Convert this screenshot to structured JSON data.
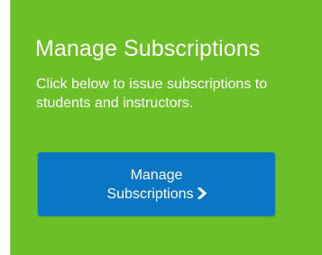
{
  "card": {
    "title": "Manage Subscriptions",
    "description": "Click below to issue subscriptions to students and instructors.",
    "background_color": "#6cbf26",
    "button": {
      "label_line1": "Manage",
      "label_line2": "Subscriptions",
      "icon": "chevron-right-icon",
      "color": "#0a77c4"
    }
  }
}
